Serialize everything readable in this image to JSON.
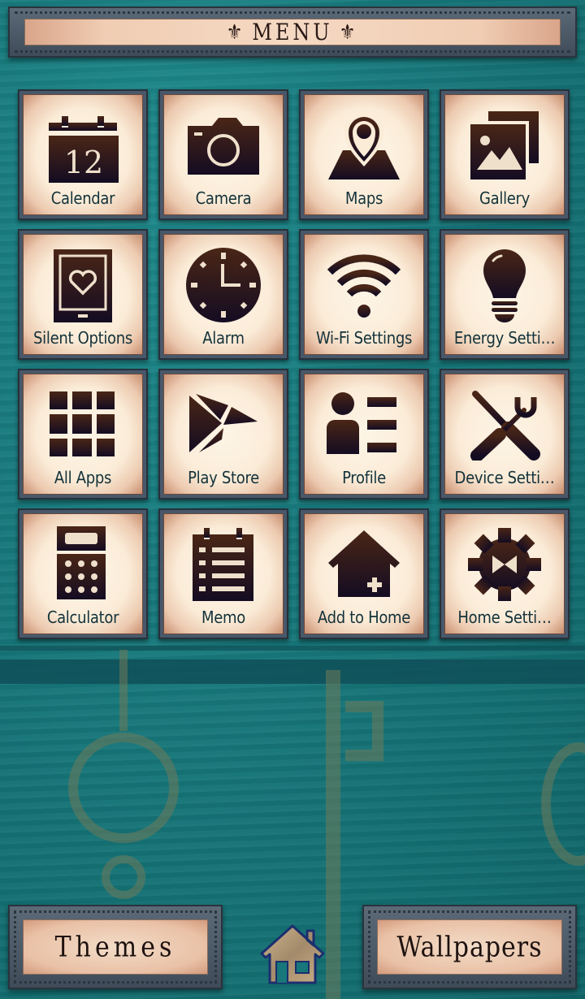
{
  "header": {
    "title": "MENU",
    "ornament_left": "⚜",
    "ornament_right": "⚜"
  },
  "grid": {
    "items": [
      {
        "label": "Calendar",
        "icon": "calendar-icon",
        "icon_text": "12"
      },
      {
        "label": "Camera",
        "icon": "camera-icon"
      },
      {
        "label": "Maps",
        "icon": "map-pin-icon"
      },
      {
        "label": "Gallery",
        "icon": "gallery-icon"
      },
      {
        "label": "Silent Options",
        "icon": "tablet-heart-icon"
      },
      {
        "label": "Alarm",
        "icon": "clock-icon"
      },
      {
        "label": "Wi-Fi Settings",
        "icon": "wifi-icon"
      },
      {
        "label": "Energy Setti…",
        "icon": "lightbulb-icon"
      },
      {
        "label": "All Apps",
        "icon": "grid-icon"
      },
      {
        "label": "Play Store",
        "icon": "play-store-icon"
      },
      {
        "label": "Profile",
        "icon": "profile-card-icon"
      },
      {
        "label": "Device Setti…",
        "icon": "tools-icon"
      },
      {
        "label": "Calculator",
        "icon": "calculator-icon"
      },
      {
        "label": "Memo",
        "icon": "memo-icon"
      },
      {
        "label": "Add to Home",
        "icon": "add-home-icon"
      },
      {
        "label": "Home Setti…",
        "icon": "gear-icon"
      }
    ]
  },
  "footer": {
    "themes_label": "Themes",
    "wallpapers_label": "Wallpapers",
    "home_icon": "home-icon"
  },
  "colors": {
    "background": "#17777a",
    "frame": "#48586a",
    "tile_face": "#fbecd8",
    "icon": "#2a1510",
    "label": "#13323a"
  }
}
